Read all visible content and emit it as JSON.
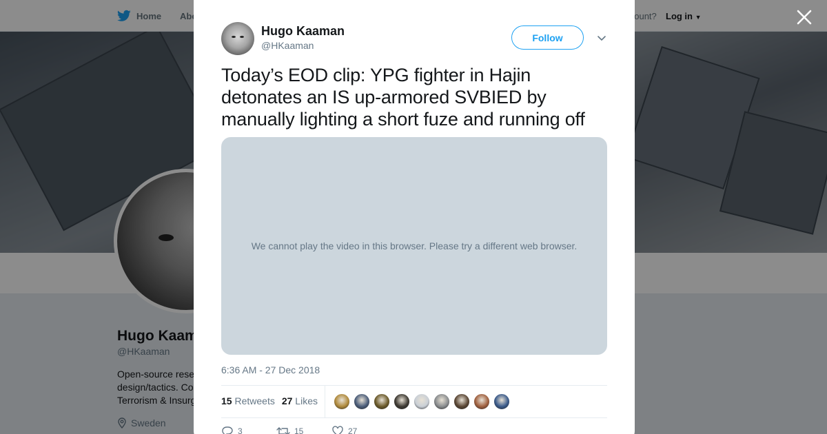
{
  "nav": {
    "home_label": "Home",
    "about_label": "Abo",
    "account_prompt": "account?",
    "login_label": "Log in"
  },
  "profile": {
    "name": "Hugo Kaam",
    "handle": "@HKaaman",
    "bio_lines": [
      "Open-source rese",
      "design/tactics. Co",
      "Terrorism & Insurg"
    ],
    "location": "Sweden"
  },
  "tweet": {
    "author_name": "Hugo Kaaman",
    "author_handle": "@HKaaman",
    "follow_label": "Follow",
    "text": "Today’s EOD clip: YPG fighter in Hajin detonates an IS up-armored SVBIED by manually lighting a short fuze and running off",
    "video_message": "We cannot play the video in this browser. Please try a different web browser.",
    "timestamp": "6:36 AM - 27 Dec 2018",
    "retweets_count": "15",
    "retweets_label": "Retweets",
    "likes_count": "27",
    "likes_label": "Likes",
    "reply_count": "3",
    "retweet_action_count": "15",
    "like_action_count": "27"
  },
  "liker_avatar_colors": [
    "#b08a3c",
    "#4b5d7a",
    "#6b5a2a",
    "#3e3a33",
    "#c9cfd6",
    "#8a8d8f",
    "#5a4634",
    "#a0603f",
    "#3a5a8a"
  ],
  "colors": {
    "brand": "#1da1f2",
    "text_primary": "#14171a",
    "text_secondary": "#657786",
    "video_bg": "#ccd6dd"
  }
}
